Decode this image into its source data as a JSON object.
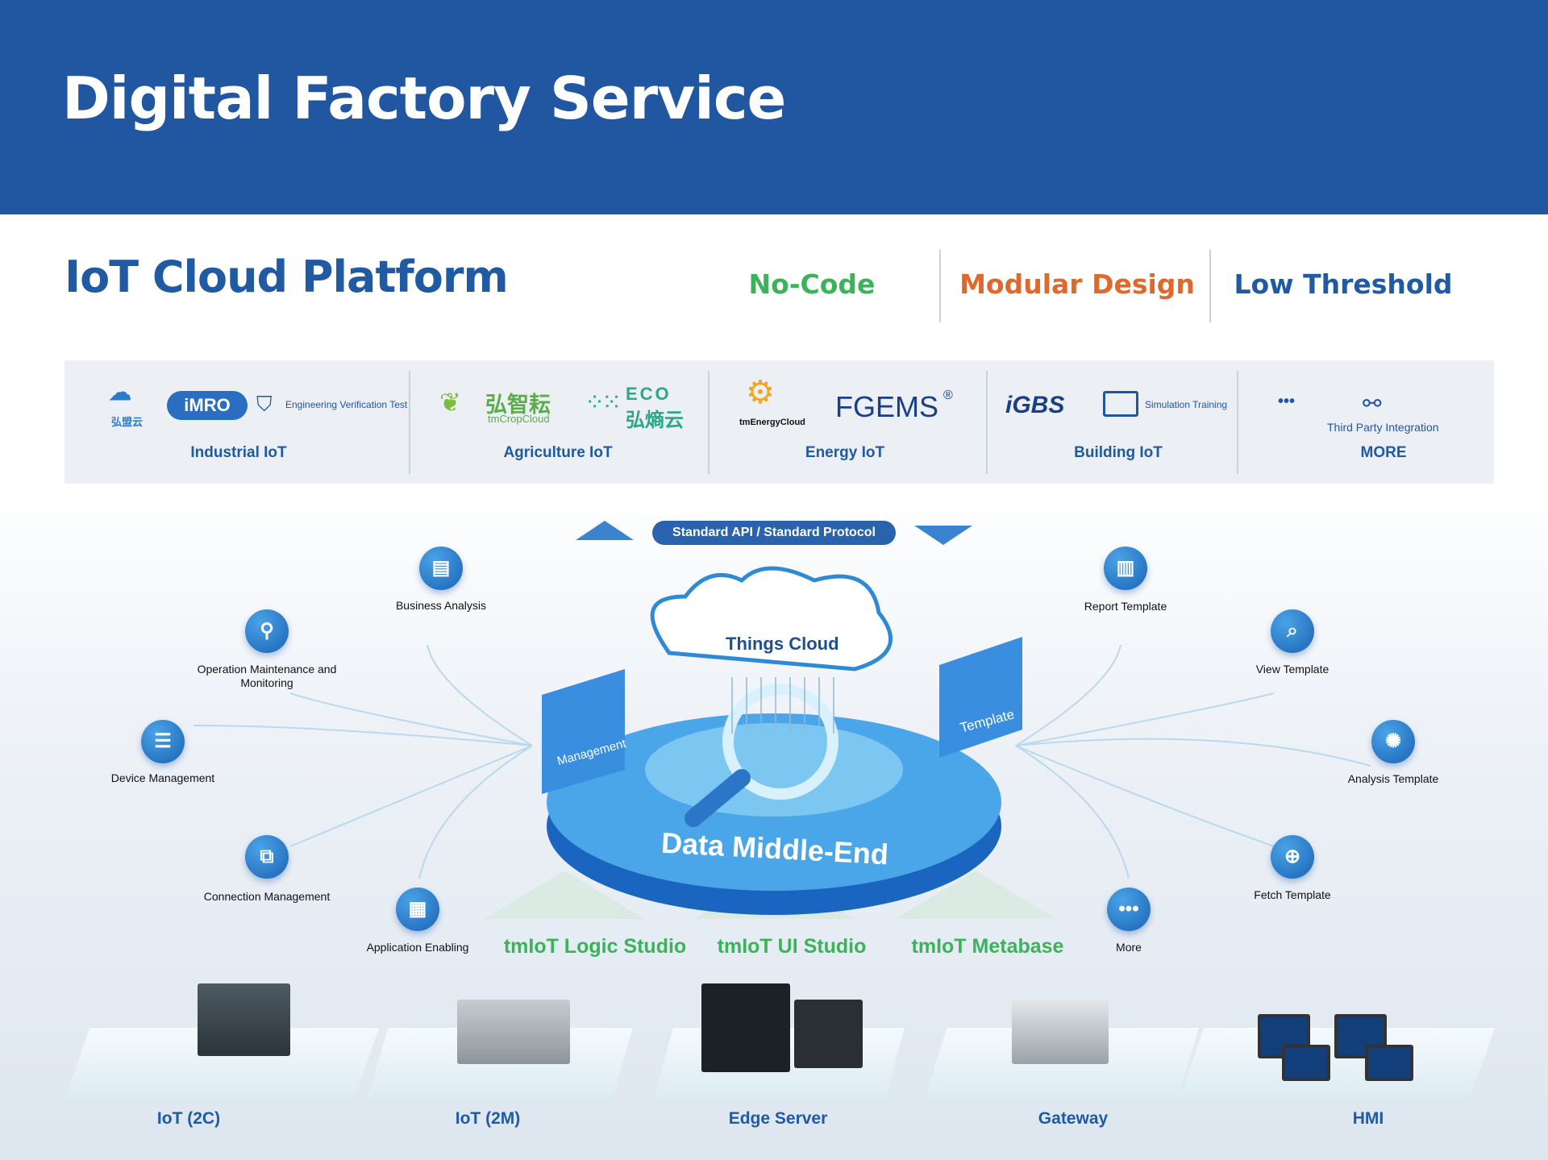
{
  "header": {
    "title": "Digital Factory Service"
  },
  "section": {
    "title": "IoT Cloud Platform"
  },
  "features": [
    {
      "label": "No-Code",
      "color": "#3cb35a"
    },
    {
      "label": "Modular Design",
      "color": "#e0682d"
    },
    {
      "label": "Low Threshold",
      "color": "#1f5aa3"
    }
  ],
  "categories": [
    {
      "label": "Industrial IoT",
      "logos": [
        "弘盟云",
        "iMRO",
        "Engineering Verification Test"
      ]
    },
    {
      "label": "Agriculture IoT",
      "logos": [
        "弘智耘",
        "tmCropCloud",
        "ECO",
        "弘熵云"
      ]
    },
    {
      "label": "Energy IoT",
      "logos": [
        "tmEnergyCloud",
        "FGEMS",
        "®"
      ]
    },
    {
      "label": "Building IoT",
      "logos": [
        "iGBS",
        "Simulation Training"
      ]
    },
    {
      "label": "MORE",
      "logos": [
        "•••",
        "Third Party Integration"
      ]
    }
  ],
  "api_label": "Standard API / Standard Protocol",
  "center": {
    "cloud": "Things Cloud",
    "disc": "Data Middle-End",
    "left_card": "Management",
    "right_card": "Template"
  },
  "left_modules": [
    "Business Analysis",
    "Operation Maintenance and Monitoring",
    "Device Management",
    "Connection Management",
    "Application Enabling"
  ],
  "right_modules": [
    "Report Template",
    "View Template",
    "Analysis Template",
    "Fetch Template",
    "More"
  ],
  "studios": [
    "tmIoT Logic Studio",
    "tmIoT UI Studio",
    "tmIoT Metabase"
  ],
  "devices": [
    "IoT (2C)",
    "IoT (2M)",
    "Edge Server",
    "Gateway",
    "HMI"
  ],
  "colors": {
    "brand": "#2156a0",
    "green": "#3cb35a",
    "orange": "#e0682d"
  }
}
